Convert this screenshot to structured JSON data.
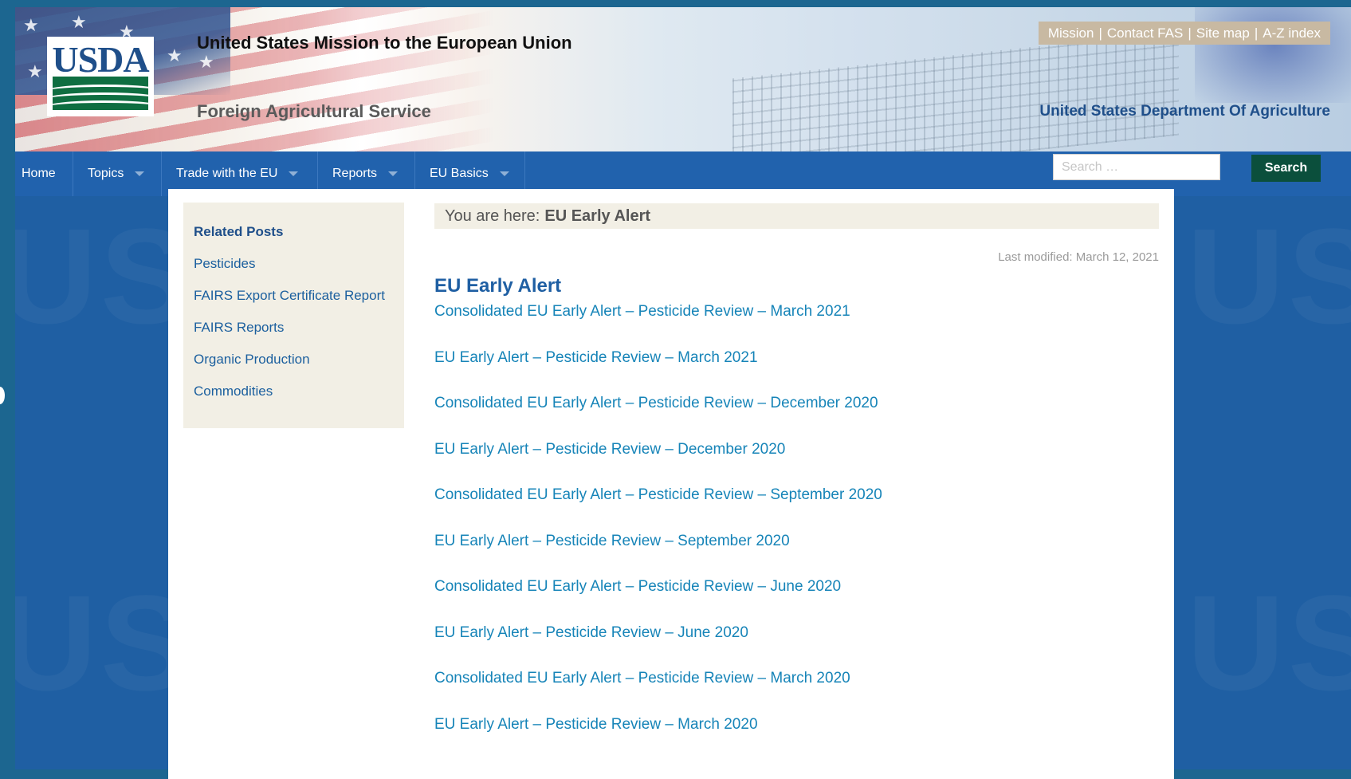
{
  "header": {
    "logo_text": "USDA",
    "site_title": "United States Mission to the European Union",
    "site_subtitle": "Foreign Agricultural Service",
    "agency_name": "United States Department Of Agriculture",
    "util_links": [
      "Mission",
      "Contact FAS",
      "Site map",
      "A-Z index"
    ]
  },
  "nav": {
    "items": [
      {
        "label": "Home"
      },
      {
        "label": "Topics"
      },
      {
        "label": "Trade with the EU"
      },
      {
        "label": "Reports"
      },
      {
        "label": "EU Basics"
      }
    ],
    "search_placeholder": "Search …",
    "search_button": "Search"
  },
  "sidebar": {
    "title": "Related Posts",
    "items": [
      "Pesticides",
      "FAIRS Export Certificate Report",
      "FAIRS Reports",
      "Organic Production",
      "Commodities"
    ]
  },
  "breadcrumb": {
    "prefix": "You are here:",
    "current": "EU Early Alert"
  },
  "main": {
    "last_modified": "Last modified: March 12, 2021",
    "title": "EU Early Alert",
    "links": [
      "Consolidated EU Early Alert – Pesticide Review – March 2021",
      "EU Early Alert – Pesticide Review – March 2021",
      "Consolidated EU Early Alert – Pesticide Review – December 2020",
      "EU Early Alert – Pesticide Review – December 2020",
      "Consolidated EU Early Alert – Pesticide Review – September 2020",
      "EU Early Alert – Pesticide Review – September 2020",
      "Consolidated EU Early Alert – Pesticide Review – June 2020",
      "EU Early Alert – Pesticide Review – June 2020",
      "Consolidated EU Early Alert – Pesticide Review – March 2020",
      "EU Early Alert – Pesticide Review – March 2020"
    ]
  },
  "colors": {
    "nav_bg": "#2162ad",
    "link": "#1684b8",
    "title_blue": "#1f5fa3",
    "search_button_bg": "#0b4f3c",
    "sidebar_bg": "#f2efe5"
  }
}
